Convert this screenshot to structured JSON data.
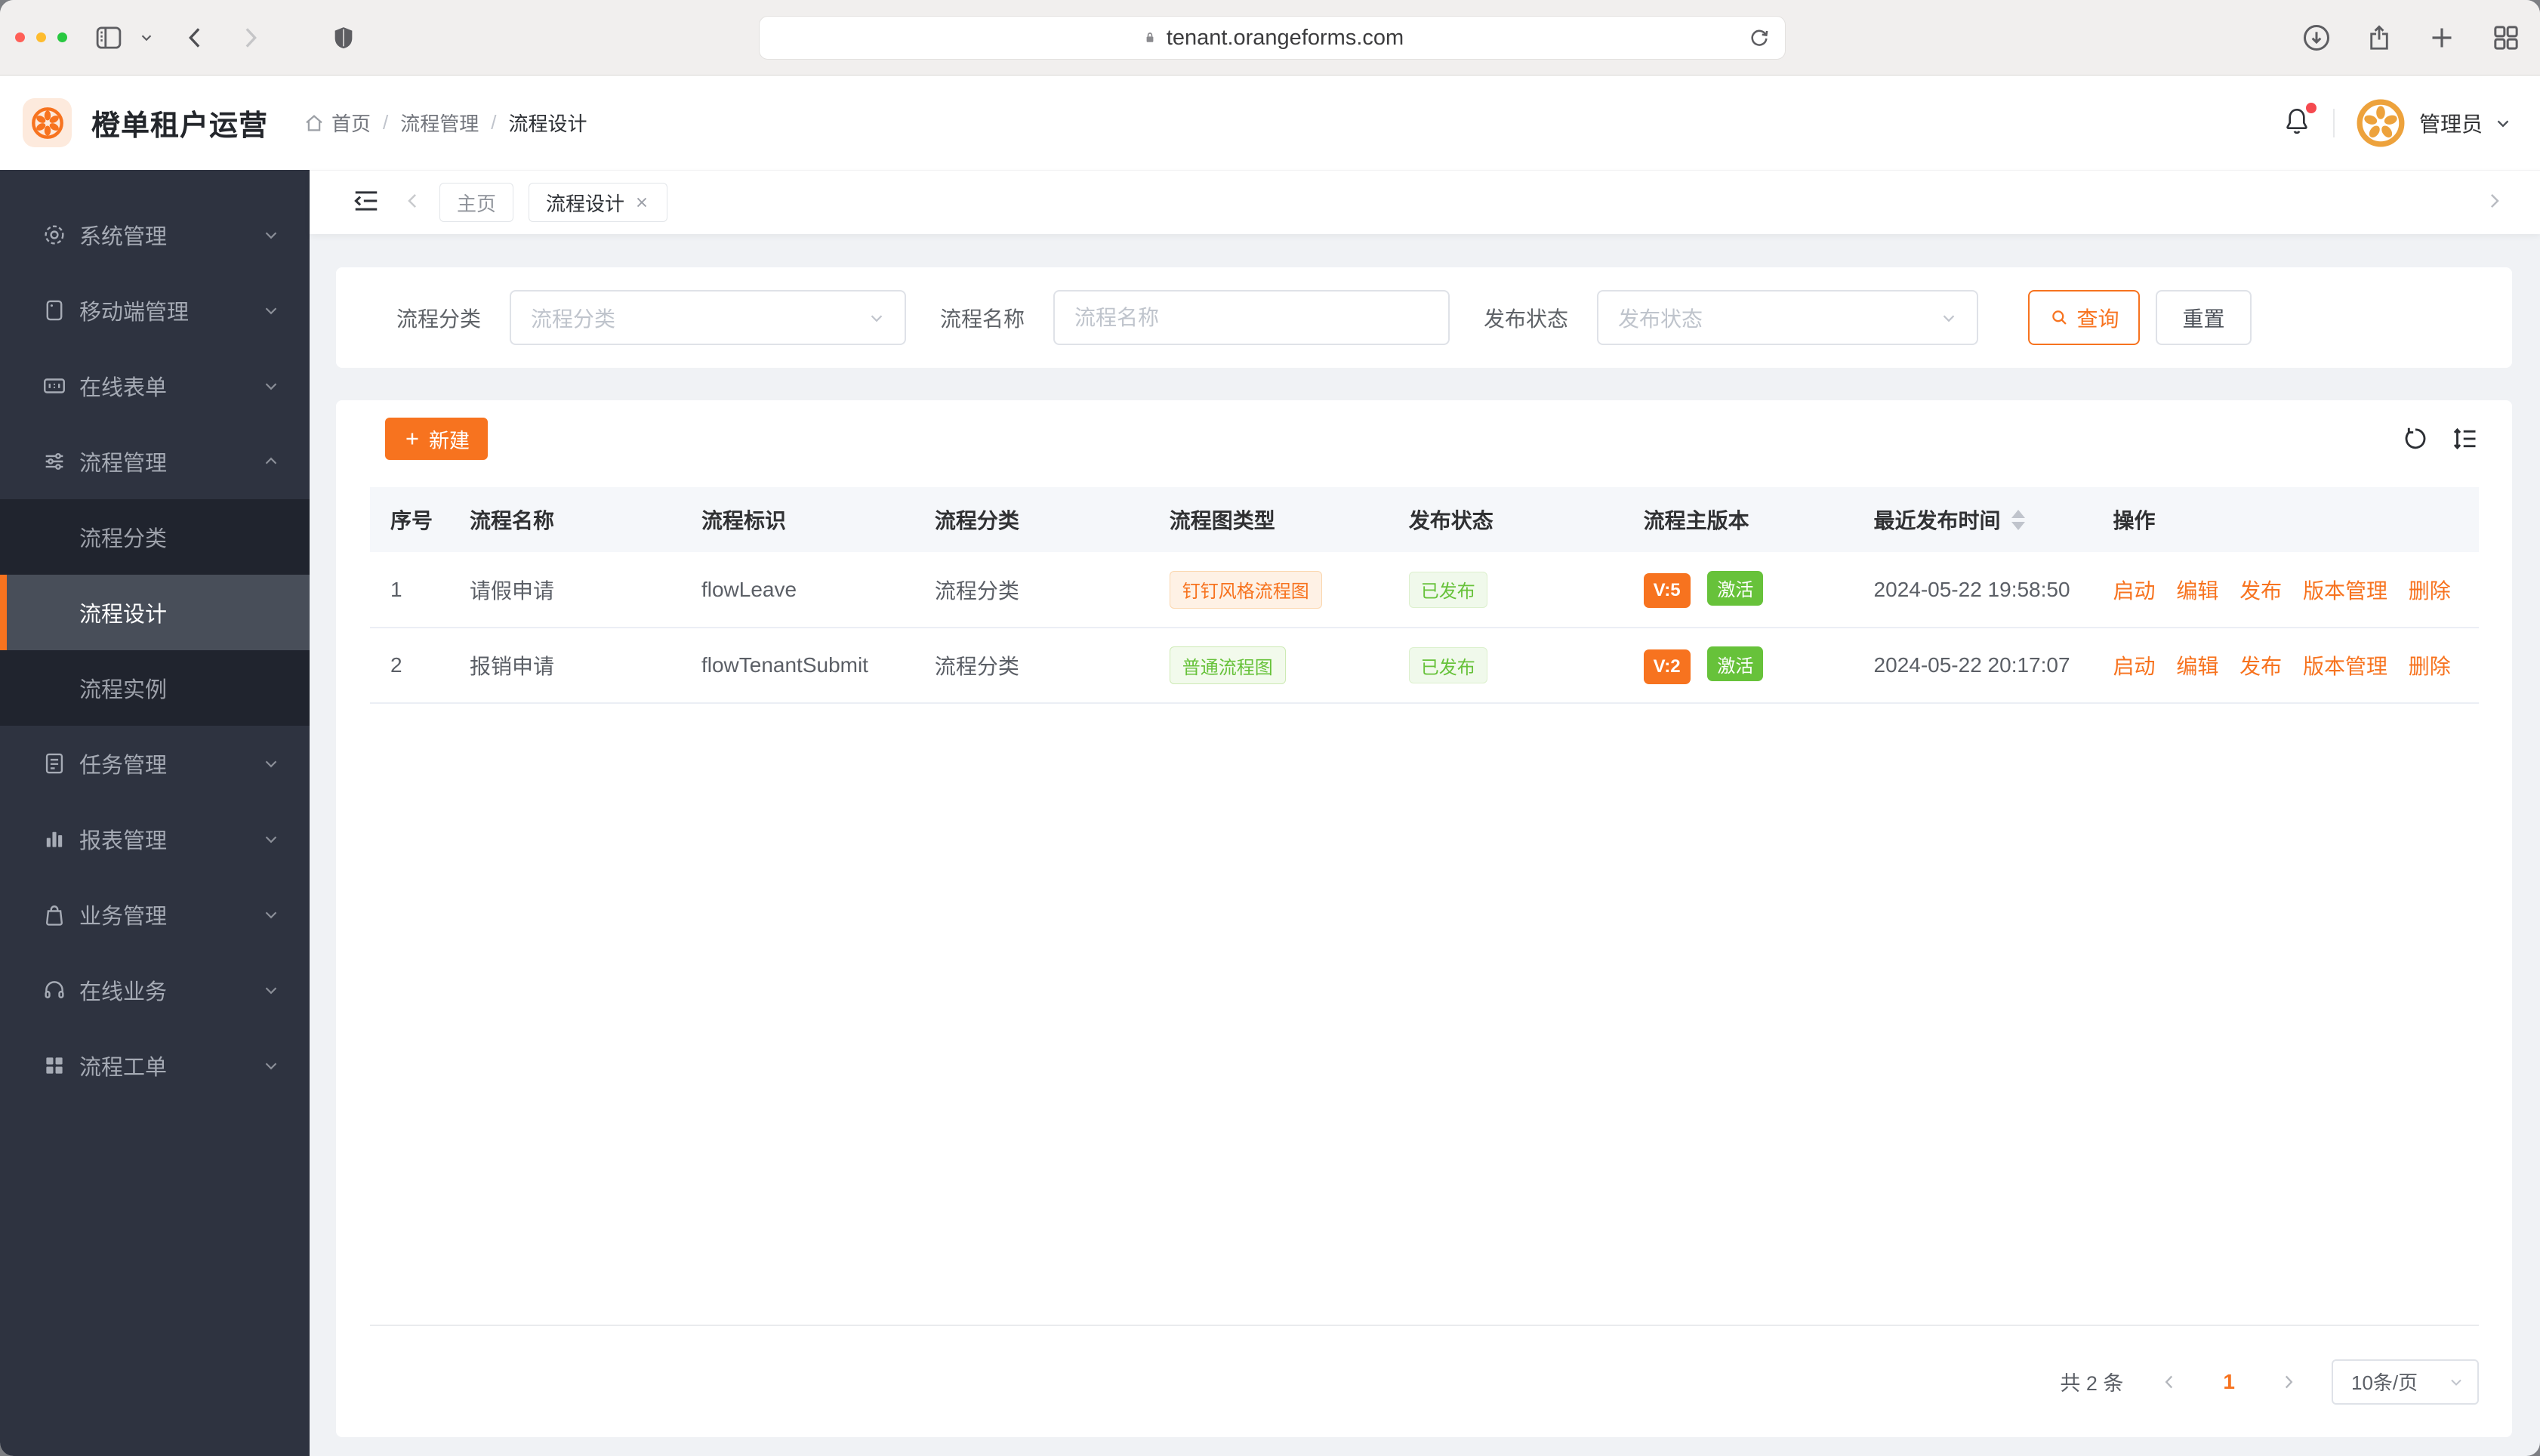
{
  "browser": {
    "url": "tenant.orangeforms.com"
  },
  "header": {
    "app_title": "橙单租户运营",
    "breadcrumb": {
      "home": "首页",
      "level1": "流程管理",
      "level2": "流程设计",
      "sep": "/"
    },
    "user_name": "管理员"
  },
  "sidebar": {
    "items": [
      {
        "label": "系统管理"
      },
      {
        "label": "移动端管理"
      },
      {
        "label": "在线表单"
      },
      {
        "label": "流程管理"
      },
      {
        "label": "任务管理"
      },
      {
        "label": "报表管理"
      },
      {
        "label": "业务管理"
      },
      {
        "label": "在线业务"
      },
      {
        "label": "流程工单"
      }
    ],
    "submenu": [
      {
        "label": "流程分类"
      },
      {
        "label": "流程设计"
      },
      {
        "label": "流程实例"
      }
    ]
  },
  "tabs": {
    "home": "主页",
    "active": "流程设计"
  },
  "filters": {
    "category_label": "流程分类",
    "category_placeholder": "流程分类",
    "name_label": "流程名称",
    "name_placeholder": "流程名称",
    "status_label": "发布状态",
    "status_placeholder": "发布状态",
    "search": "查询",
    "reset": "重置"
  },
  "toolbar": {
    "create": "新建"
  },
  "table": {
    "headers": [
      "序号",
      "流程名称",
      "流程标识",
      "流程分类",
      "流程图类型",
      "发布状态",
      "流程主版本",
      "最近发布时间",
      "操作"
    ],
    "actions": [
      "启动",
      "编辑",
      "发布",
      "版本管理",
      "删除"
    ],
    "rows": [
      {
        "index": "1",
        "name": "请假申请",
        "key": "flowLeave",
        "category": "流程分类",
        "diagram_type": "钉钉风格流程图",
        "publish_status": "已发布",
        "version": "V:5",
        "active_status": "激活",
        "published_at": "2024-05-22 19:58:50"
      },
      {
        "index": "2",
        "name": "报销申请",
        "key": "flowTenantSubmit",
        "category": "流程分类",
        "diagram_type": "普通流程图",
        "publish_status": "已发布",
        "version": "V:2",
        "active_status": "激活",
        "published_at": "2024-05-22 20:17:07"
      }
    ]
  },
  "pagination": {
    "total": "共 2 条",
    "page": "1",
    "size": "10条/页"
  },
  "colors": {
    "accent": "#f7731f",
    "green": "#67c23a",
    "sidebar_bg": "#2e3340"
  }
}
